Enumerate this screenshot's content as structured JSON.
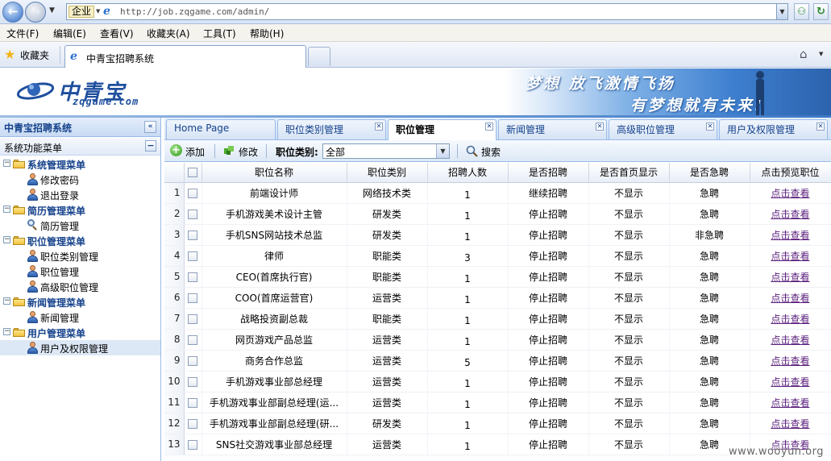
{
  "browser": {
    "address_tag": "企业",
    "url": "http://job.zqgame.com/admin/",
    "menu": [
      "文件(F)",
      "编辑(E)",
      "查看(V)",
      "收藏夹(A)",
      "工具(T)",
      "帮助(H)"
    ],
    "favorites_label": "收藏夹",
    "tab_title": "中青宝招聘系统"
  },
  "banner": {
    "logo_text": "中青宝",
    "logo_sub": "zqgame.com",
    "slogan_line1": "梦想 放飞激情飞扬",
    "slogan_line2": "有梦想就有未来!"
  },
  "sidebar": {
    "title": "中青宝招聘系统",
    "section": "系统功能菜单",
    "tree": [
      {
        "type": "cat",
        "label": "系统管理菜单"
      },
      {
        "type": "leaf",
        "icon": "user-icon",
        "label": "修改密码"
      },
      {
        "type": "leaf",
        "icon": "user-icon",
        "label": "退出登录"
      },
      {
        "type": "cat",
        "label": "简历管理菜单"
      },
      {
        "type": "leaf",
        "icon": "search-icon",
        "label": "简历管理"
      },
      {
        "type": "cat",
        "label": "职位管理菜单"
      },
      {
        "type": "leaf",
        "icon": "user-icon",
        "label": "职位类别管理"
      },
      {
        "type": "leaf",
        "icon": "user-icon",
        "label": "职位管理"
      },
      {
        "type": "leaf",
        "icon": "user-icon",
        "label": "高级职位管理"
      },
      {
        "type": "cat",
        "label": "新闻管理菜单"
      },
      {
        "type": "leaf",
        "icon": "user-icon",
        "label": "新闻管理"
      },
      {
        "type": "cat",
        "label": "用户管理菜单"
      },
      {
        "type": "leaf",
        "icon": "user-icon",
        "label": "用户及权限管理",
        "selected": true
      }
    ]
  },
  "tabs": [
    "Home Page",
    "职位类别管理",
    "职位管理",
    "新闻管理",
    "高级职位管理",
    "用户及权限管理"
  ],
  "toolbar": {
    "add_label": "添加",
    "edit_label": "修改",
    "category_label": "职位类别:",
    "category_value": "全部",
    "search_label": "搜索"
  },
  "grid": {
    "columns": [
      "职位名称",
      "职位类别",
      "招聘人数",
      "是否招聘",
      "是否首页显示",
      "是否急聘",
      "点击预览职位"
    ],
    "rows": [
      {
        "n": "1",
        "name": "前端设计师",
        "category": "网络技术类",
        "count": "1",
        "recruiting": "继续招聘",
        "homepage": "不显示",
        "urgent": "急聘",
        "preview": "点击查看"
      },
      {
        "n": "2",
        "name": "手机游戏美术设计主管",
        "category": "研发类",
        "count": "1",
        "recruiting": "停止招聘",
        "homepage": "不显示",
        "urgent": "急聘",
        "preview": "点击查看"
      },
      {
        "n": "3",
        "name": "手机SNS网站技术总监",
        "category": "研发类",
        "count": "1",
        "recruiting": "停止招聘",
        "homepage": "不显示",
        "urgent": "非急聘",
        "preview": "点击查看"
      },
      {
        "n": "4",
        "name": "律师",
        "category": "职能类",
        "count": "3",
        "recruiting": "停止招聘",
        "homepage": "不显示",
        "urgent": "急聘",
        "preview": "点击查看"
      },
      {
        "n": "5",
        "name": "CEO(首席执行官)",
        "category": "职能类",
        "count": "1",
        "recruiting": "停止招聘",
        "homepage": "不显示",
        "urgent": "急聘",
        "preview": "点击查看"
      },
      {
        "n": "6",
        "name": "COO(首席运营官)",
        "category": "运营类",
        "count": "1",
        "recruiting": "停止招聘",
        "homepage": "不显示",
        "urgent": "急聘",
        "preview": "点击查看"
      },
      {
        "n": "7",
        "name": "战略投资副总裁",
        "category": "职能类",
        "count": "1",
        "recruiting": "停止招聘",
        "homepage": "不显示",
        "urgent": "急聘",
        "preview": "点击查看"
      },
      {
        "n": "8",
        "name": "网页游戏产品总监",
        "category": "运营类",
        "count": "1",
        "recruiting": "停止招聘",
        "homepage": "不显示",
        "urgent": "急聘",
        "preview": "点击查看"
      },
      {
        "n": "9",
        "name": "商务合作总监",
        "category": "运营类",
        "count": "5",
        "recruiting": "停止招聘",
        "homepage": "不显示",
        "urgent": "急聘",
        "preview": "点击查看"
      },
      {
        "n": "10",
        "name": "手机游戏事业部总经理",
        "category": "运营类",
        "count": "1",
        "recruiting": "停止招聘",
        "homepage": "不显示",
        "urgent": "急聘",
        "preview": "点击查看"
      },
      {
        "n": "11",
        "name": "手机游戏事业部副总经理(运...",
        "category": "运营类",
        "count": "1",
        "recruiting": "停止招聘",
        "homepage": "不显示",
        "urgent": "急聘",
        "preview": "点击查看"
      },
      {
        "n": "12",
        "name": "手机游戏事业部副总经理(研...",
        "category": "研发类",
        "count": "1",
        "recruiting": "停止招聘",
        "homepage": "不显示",
        "urgent": "急聘",
        "preview": "点击查看"
      },
      {
        "n": "13",
        "name": "SNS社交游戏事业部总经理",
        "category": "运营类",
        "count": "1",
        "recruiting": "停止招聘",
        "homepage": "不显示",
        "urgent": "急聘",
        "preview": "点击查看"
      }
    ]
  },
  "watermark": "www.wooyun.org"
}
